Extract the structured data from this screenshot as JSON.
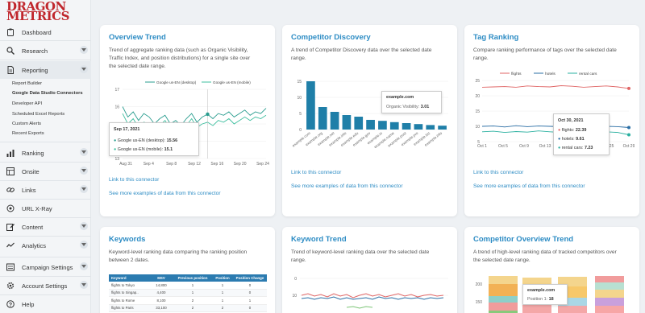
{
  "brand": {
    "line1": "DRAGON",
    "line2": "METRICS",
    "color": "#c0272d"
  },
  "sidebar": {
    "items": [
      {
        "label": "Dashboard",
        "icon": "clipboard-icon"
      },
      {
        "label": "Research",
        "icon": "magnifier-icon"
      },
      {
        "label": "Reporting",
        "icon": "document-icon"
      },
      {
        "label": "Ranking",
        "icon": "bar-chart-icon"
      },
      {
        "label": "Onsite",
        "icon": "grid-icon"
      },
      {
        "label": "Links",
        "icon": "link-icon"
      },
      {
        "label": "URL X-Ray",
        "icon": "xray-icon"
      },
      {
        "label": "Content",
        "icon": "pencil-icon"
      },
      {
        "label": "Analytics",
        "icon": "trend-icon"
      },
      {
        "label": "Campaign Settings",
        "icon": "sliders-icon"
      },
      {
        "label": "Account Settings",
        "icon": "gear-icon"
      },
      {
        "label": "Help",
        "icon": "question-icon"
      }
    ],
    "reporting_sub": [
      "Report Builder",
      "Google Data Studio Connectors",
      "Developer API",
      "Scheduled Excel Reports",
      "Custom Alerts",
      "Recent Exports"
    ]
  },
  "cards": {
    "overview": {
      "title": "Overview Trend",
      "desc1": "Trend of aggregate ranking data (such as Organic Visibility,",
      "desc2": "Traffic Index, and position distributions) for a single site over",
      "desc3": "the selected date range.",
      "link1": "Link to this connector",
      "link2": "See more examples of data from this connector",
      "legend1": "Google us-EN (desktop)",
      "legend2": "Google us-EN (mobile)",
      "tooltip_date": "Sep 17, 2021",
      "tooltip_row1_label": "Google us-EN (desktop):",
      "tooltip_row1_value": "15.56",
      "tooltip_row2_label": "Google us-EN (mobile):",
      "tooltip_row2_value": "15.1",
      "y_ticks": [
        "17",
        "16",
        "15",
        "14",
        "13"
      ],
      "x_ticks": [
        "Aug 31",
        "Sep 4",
        "Sep 8",
        "Sep 12",
        "Sep 16",
        "Sep 20",
        "Sep 24"
      ]
    },
    "competitor": {
      "title": "Competitor Discovery",
      "desc1": "A trend of Competitor Discovery data over the selected date",
      "desc2": "range.",
      "link1": "Link to this connector",
      "link2": "See more examples of data from this connector",
      "tooltip_site": "example.com",
      "tooltip_label": "Organic Visibility:",
      "tooltip_value": "3.01",
      "y_ticks": [
        "15",
        "10",
        "5",
        "0"
      ]
    },
    "tag": {
      "title": "Tag Ranking",
      "desc1": "Compare ranking performance of tags over the selected date",
      "desc2": "range.",
      "link1": "Link to this connector",
      "link2": "See more examples of data from this connector",
      "legend": [
        "flights",
        "hotels",
        "rental cars"
      ],
      "tooltip_date": "Oct 30, 2021",
      "tooltip_rows": [
        {
          "label": "flights:",
          "value": "22.39"
        },
        {
          "label": "hotels:",
          "value": "9.61"
        },
        {
          "label": "rental cars:",
          "value": "7.23"
        }
      ],
      "y_ticks": [
        "25",
        "20",
        "15",
        "10",
        "5"
      ],
      "x_ticks": [
        "Oct 1",
        "Oct 5",
        "Oct 9",
        "Oct 13",
        "Oct 17",
        "Oct 21",
        "Oct 25",
        "Oct 29"
      ]
    },
    "keywords": {
      "title": "Keywords",
      "desc1": "Keyword-level ranking data comparing the ranking position",
      "desc2": "between 2 dates.",
      "columns": [
        "Keyword",
        "MSV",
        "Previous position",
        "Position",
        "Position Change"
      ],
      "rows": [
        [
          "flights to Tokyo",
          "14,800",
          "1",
          "1",
          "0"
        ],
        [
          "flights to Singap..",
          "4,400",
          "1",
          "1",
          "0"
        ],
        [
          "flights to Rome",
          "8,100",
          "2",
          "1",
          "1"
        ],
        [
          "flights to Paris",
          "33,100",
          "2",
          "2",
          "0"
        ]
      ]
    },
    "keyword_trend": {
      "title": "Keyword Trend",
      "desc1": "Trend of keyword-level ranking data over the selected date",
      "desc2": "range.",
      "y_ticks": [
        "0",
        "10"
      ]
    },
    "competitor_overview": {
      "title": "Competitor Overview Trend",
      "desc1": "A trend of high-level ranking data of tracked competitors over",
      "desc2": "the selected date range.",
      "tooltip_site": "example.com",
      "tooltip_label": "Position 1:",
      "tooltip_value": "18",
      "y_ticks": [
        "200",
        "150"
      ]
    }
  },
  "chart_data": [
    {
      "type": "line",
      "title": "Overview Trend",
      "x": [
        "Aug 31",
        "Sep 4",
        "Sep 8",
        "Sep 12",
        "Sep 16",
        "Sep 20",
        "Sep 24"
      ],
      "ylim": [
        13,
        17
      ],
      "series": [
        {
          "name": "Google us-EN (desktop)",
          "color": "#2a9d8f",
          "values": [
            16.0,
            15.4,
            15.7,
            15.2,
            15.6,
            15.4,
            15.0,
            15.3,
            15.5,
            15.0,
            15.2,
            14.9,
            15.3,
            15.6,
            15.1,
            15.4,
            15.56,
            15.3,
            15.6,
            15.5,
            15.7,
            15.4,
            15.6,
            15.8,
            15.5,
            15.7,
            15.6,
            15.9
          ]
        },
        {
          "name": "Google us-EN (mobile)",
          "color": "#3fbf9f",
          "values": [
            15.6,
            15.0,
            15.3,
            14.8,
            15.1,
            15.0,
            14.6,
            14.9,
            15.2,
            14.7,
            14.9,
            14.5,
            14.9,
            15.3,
            14.8,
            15.0,
            15.1,
            14.9,
            15.2,
            15.1,
            15.3,
            15.0,
            15.2,
            15.4,
            15.2,
            15.4,
            15.3,
            15.5
          ]
        }
      ]
    },
    {
      "type": "bar",
      "title": "Competitor Discovery",
      "categories": [
        "example.com",
        "example.org",
        "example.net",
        "example.info",
        "example.edu",
        "example.gov",
        "example.io",
        "example.name",
        "example.post",
        "example.pro",
        "example.biz",
        "example.info"
      ],
      "values": [
        15,
        7,
        5.5,
        4.5,
        4,
        3.01,
        2.7,
        2.3,
        2,
        1.7,
        1.4,
        1.2
      ],
      "ylim": [
        0,
        15
      ],
      "color": "#1f7fa8"
    },
    {
      "type": "line",
      "title": "Tag Ranking",
      "x": [
        "Oct 1",
        "Oct 5",
        "Oct 9",
        "Oct 13",
        "Oct 17",
        "Oct 21",
        "Oct 25",
        "Oct 29"
      ],
      "ylim": [
        5,
        25
      ],
      "series": [
        {
          "name": "flights",
          "color": "#e06666",
          "values": [
            22.8,
            22.9,
            23.0,
            22.8,
            23.2,
            23.0,
            22.9,
            23.3,
            23.1,
            22.8,
            23.0,
            23.2,
            22.9,
            22.39
          ]
        },
        {
          "name": "hotels",
          "color": "#2b6fa6",
          "values": [
            10.0,
            10.1,
            9.8,
            10.2,
            9.9,
            10.1,
            10.0,
            9.9,
            10.1,
            10.0,
            9.8,
            10.0,
            9.9,
            9.61
          ]
        },
        {
          "name": "rental cars",
          "color": "#2ab0a0",
          "values": [
            8.2,
            8.4,
            8.0,
            8.3,
            8.1,
            8.5,
            8.2,
            8.0,
            8.3,
            8.1,
            8.4,
            8.2,
            8.0,
            7.23
          ]
        }
      ]
    }
  ]
}
